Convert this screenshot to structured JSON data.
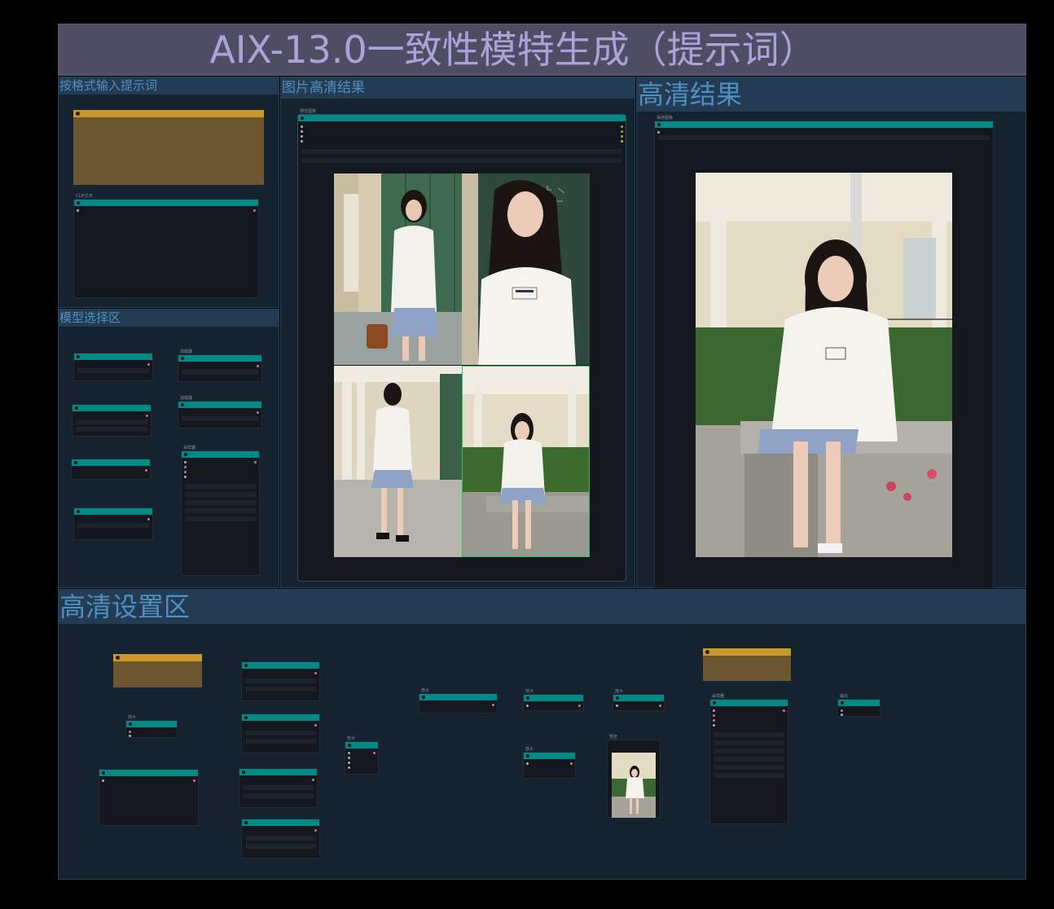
{
  "page": {
    "title": "AIX-13.0一致性模特生成（提示词）"
  },
  "groups": {
    "prompt_input": {
      "title": "按格式输入提示词"
    },
    "model_select": {
      "title": "模型选择区"
    },
    "image_hd": {
      "title": "图片高清结果"
    },
    "hd_result": {
      "title": "高清结果"
    },
    "hd_settings": {
      "title": "高清设置区"
    }
  },
  "nodes": {
    "prompt_text_label": "CLIP文本",
    "model_loader_a": "加载器",
    "model_loader_b": "加载器",
    "sampler": "采样器",
    "image_preview": "预览图像",
    "save_image": "保存图像",
    "upscale_a": "放大",
    "upscale_b": "放大",
    "upscale_c": "放大",
    "upscale_d": "放大",
    "upscale_e": "放大",
    "upscale_f": "放大",
    "preview_small": "预览",
    "sampler_hd": "采样器",
    "output_node": "输出"
  },
  "colors": {
    "node_header": "#008a86",
    "note_header": "#c8982a",
    "group_header": "#243c53",
    "group_title": "#4f8fc0",
    "page_title": "#a7a5d8"
  },
  "images": {
    "grid_photos": [
      "model-by-lockers",
      "model-portrait-chalkboard",
      "model-walking-hallway",
      "model-seated-bench"
    ],
    "hd_photo": "model-seated-bench-hd",
    "thumb_photo": "model-seated-bench-thumb"
  }
}
